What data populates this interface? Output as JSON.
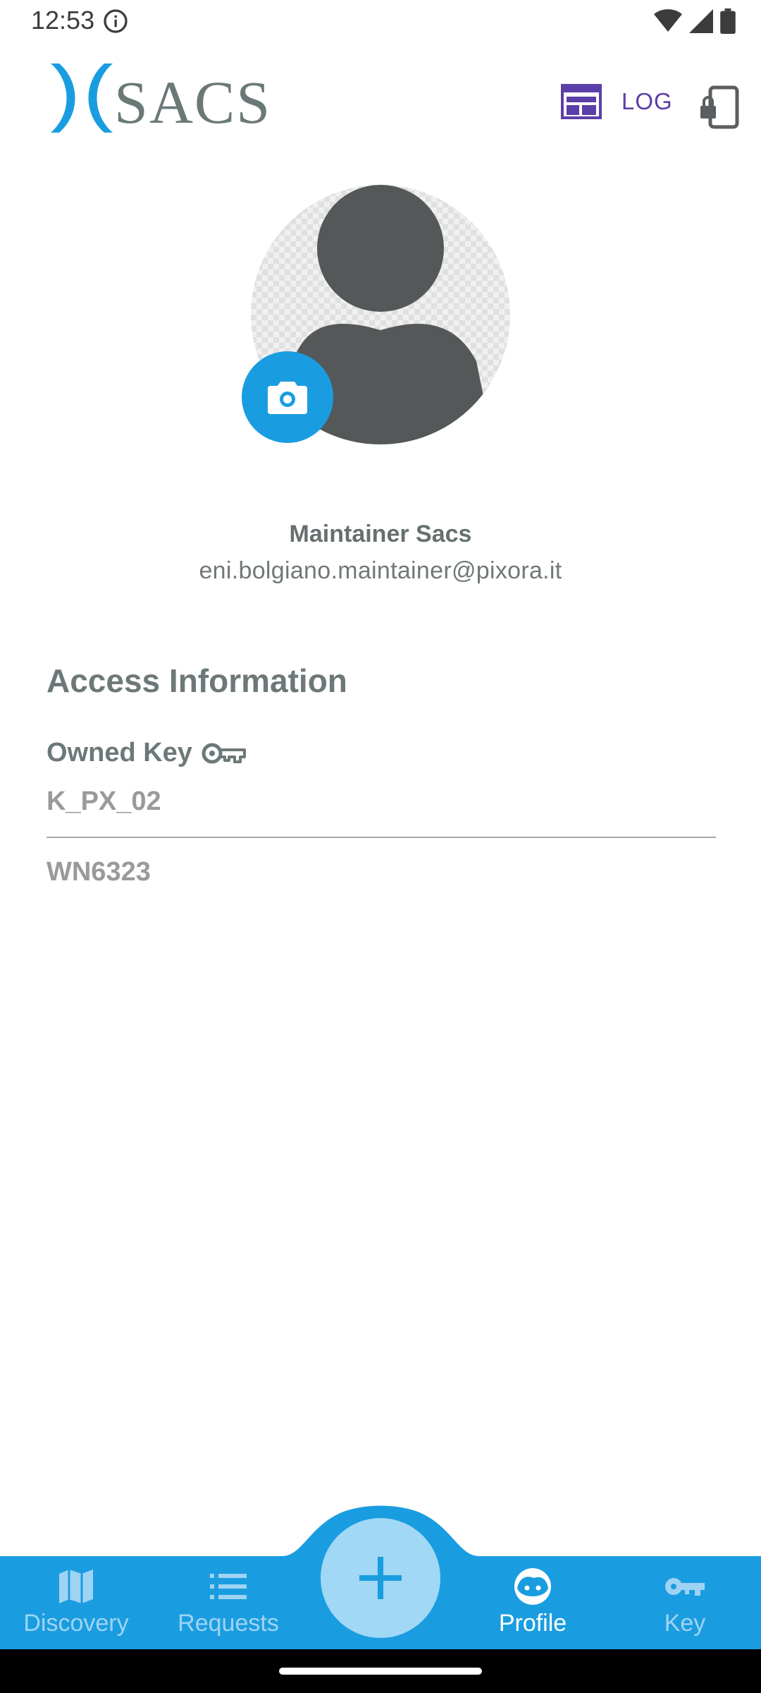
{
  "status_bar": {
    "time": "12:53"
  },
  "header": {
    "logo_text": "SACS",
    "log_label": "LOG"
  },
  "profile": {
    "name": "Maintainer Sacs",
    "email": "eni.bolgiano.maintainer@pixora.it"
  },
  "access": {
    "title": "Access Information",
    "owned_key_label": "Owned Key",
    "keys": [
      "K_PX_02",
      "WN6323"
    ]
  },
  "bottom_nav": {
    "items": [
      {
        "label": "Discovery",
        "icon": "map-icon"
      },
      {
        "label": "Requests",
        "icon": "list-icon"
      },
      {
        "label": "Profile",
        "icon": "face-icon",
        "active": true
      },
      {
        "label": "Key",
        "icon": "key-icon"
      }
    ],
    "fab_icon": "plus-icon"
  },
  "colors": {
    "accent": "#1a9de0",
    "log_purple": "#5b3fa8",
    "text_gray": "#6d7878"
  }
}
